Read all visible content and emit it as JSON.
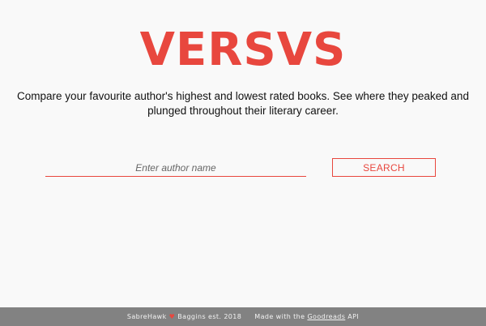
{
  "header": {
    "logo_text": "VERSVS",
    "tagline": "Compare your favourite author's highest and lowest rated books. See where they peaked and plunged throughout their literary career."
  },
  "search": {
    "placeholder": "Enter author name",
    "value": "",
    "button_label": "SEARCH"
  },
  "footer": {
    "author_one": "SabreHawk",
    "heart_symbol": "♥",
    "author_two": "Baggins est. 2018",
    "made_with_prefix": "Made with the",
    "goodreads_link": "Goodreads",
    "made_with_suffix": "API"
  },
  "colors": {
    "accent": "#e8473e",
    "background": "#f9f9f9",
    "footer_background": "#828282"
  }
}
